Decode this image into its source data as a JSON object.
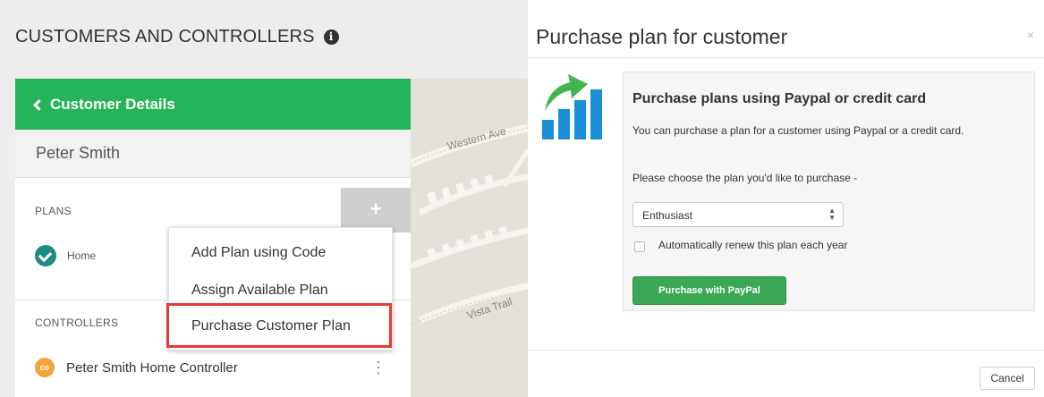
{
  "page": {
    "title": "CUSTOMERS AND CONTROLLERS",
    "info_icon": "info-icon"
  },
  "customer": {
    "back_label": "Customer Details",
    "name": "Peter Smith"
  },
  "plans": {
    "section_label": "PLANS",
    "add_button": "+",
    "items": [
      {
        "name": "Home",
        "status_icon": "check-icon",
        "status_color": "#1f8a82"
      }
    ]
  },
  "plan_menu": {
    "items": [
      {
        "label": "Add Plan using Code"
      },
      {
        "label": "Assign Available Plan"
      },
      {
        "label": "Purchase Customer Plan",
        "highlighted": true
      }
    ],
    "highlight_color": "#e53935"
  },
  "controllers": {
    "section_label": "CONTROLLERS",
    "items": [
      {
        "name": "Peter Smith Home Controller",
        "icon": "controller-icon",
        "icon_color": "#f3a43a",
        "menu_icon": "kebab-icon"
      }
    ]
  },
  "map": {
    "labels": [
      "Western Ave",
      "Vista Trail"
    ]
  },
  "modal": {
    "title": "Purchase plan for customer",
    "close_label": "×",
    "icon": "growth-chart-icon",
    "box_title": "Purchase plans using Paypal or credit card",
    "description": "You can purchase a plan for a customer using Paypal or a credit card.",
    "choose_label": "Please choose the plan you'd like to purchase -",
    "plan_select": {
      "selected": "Enthusiast"
    },
    "auto_renew_label": "Automatically renew this plan each year",
    "auto_renew_checked": false,
    "purchase_button": "Purchase with PayPal",
    "cancel_button": "Cancel"
  },
  "colors": {
    "header_green": "#26b45a",
    "button_green": "#3aa855",
    "chart_blue": "#1a8fd6",
    "arrow_green": "#3fb64e"
  }
}
